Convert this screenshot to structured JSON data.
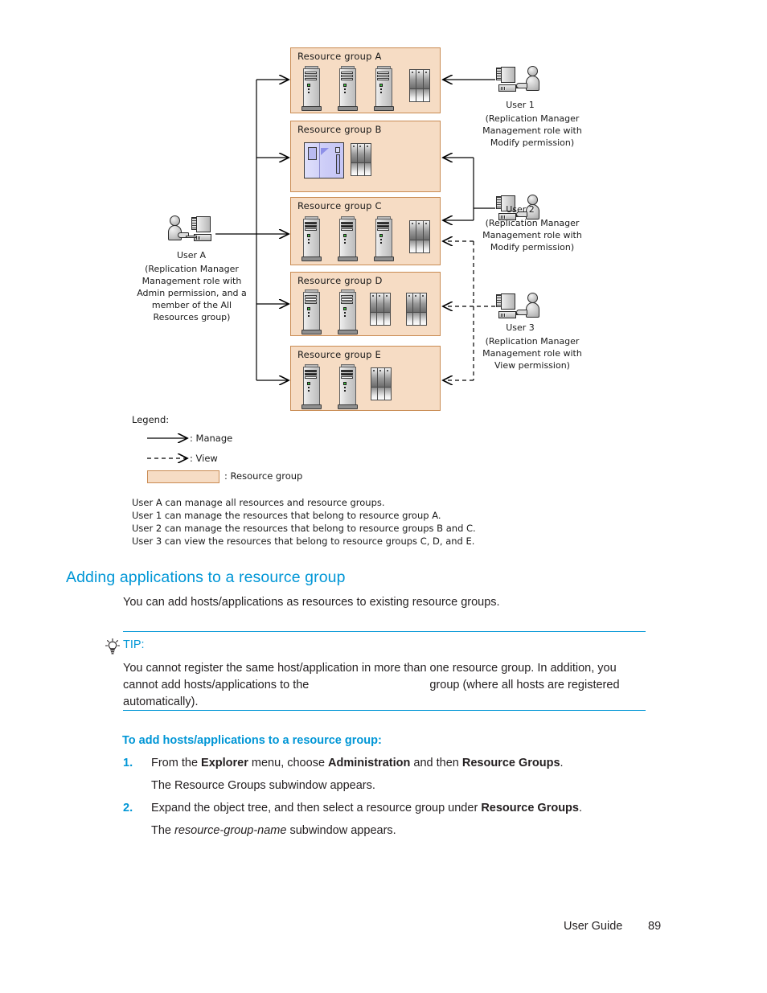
{
  "figure": {
    "resource_groups": [
      {
        "id": "A",
        "title": "Resource group A",
        "servers": 3,
        "arrays": 1,
        "app": false,
        "dark": false
      },
      {
        "id": "B",
        "title": "Resource group B",
        "servers": 0,
        "arrays": 1,
        "app": true,
        "dark": false
      },
      {
        "id": "C",
        "title": "Resource group C",
        "servers": 3,
        "arrays": 1,
        "app": false,
        "dark": true
      },
      {
        "id": "D",
        "title": "Resource group D",
        "servers": 2,
        "arrays": 2,
        "app": false,
        "dark": false
      },
      {
        "id": "E",
        "title": "Resource group E",
        "servers": 2,
        "arrays": 1,
        "app": false,
        "dark": true
      }
    ],
    "users": [
      {
        "key": "userA",
        "name": "User A",
        "detail": "(Replication Manager\nManagement role with\nAdmin permission, and a\nmember of the All\nResources group)"
      },
      {
        "key": "user1",
        "name": "User 1",
        "detail": "(Replication Manager\nManagement role with\nModify permission)"
      },
      {
        "key": "user2",
        "name": "User 2",
        "detail": "(Replication Manager\nManagement role with\nModify permission)"
      },
      {
        "key": "user3",
        "name": "User 3",
        "detail": "(Replication Manager\nManagement role with\nView permission)"
      }
    ],
    "legend": {
      "title": "Legend:",
      "manage": ": Manage",
      "view": ": View",
      "resource_group": ": Resource group"
    },
    "notes": [
      "User A can manage all resources and resource groups.",
      "User 1 can manage the resources that belong to resource group A.",
      "User 2 can manage the resources that belong to resource groups B and C.",
      "User 3 can view the resources that belong to resource groups C, D, and E."
    ]
  },
  "content": {
    "heading": "Adding applications to a resource group",
    "intro": "You can add hosts/applications as resources to existing resource groups.",
    "tip": {
      "label": "TIP:",
      "text_before_gap": "You cannot register the same host/application in more than one resource group. In addition, you cannot add hosts/applications to the",
      "text_after_gap": "group (where all hosts are registered automatically)."
    },
    "task_title": "To add hosts/applications to a resource group:",
    "steps": [
      {
        "num": "1.",
        "parts": [
          {
            "t": "From the ",
            "b": false,
            "i": false
          },
          {
            "t": "Explorer",
            "b": true,
            "i": false
          },
          {
            "t": " menu, choose ",
            "b": false,
            "i": false
          },
          {
            "t": "Administration",
            "b": true,
            "i": false
          },
          {
            "t": " and then ",
            "b": false,
            "i": false
          },
          {
            "t": "Resource Groups",
            "b": true,
            "i": false
          },
          {
            "t": ".",
            "b": false,
            "i": false
          }
        ],
        "result_parts": [
          {
            "t": "The Resource Groups subwindow appears.",
            "b": false,
            "i": false
          }
        ]
      },
      {
        "num": "2.",
        "parts": [
          {
            "t": "Expand the object tree, and then select a resource group under ",
            "b": false,
            "i": false
          },
          {
            "t": "Resource Groups",
            "b": true,
            "i": false
          },
          {
            "t": ".",
            "b": false,
            "i": false
          }
        ],
        "result_parts": [
          {
            "t": "The ",
            "b": false,
            "i": false
          },
          {
            "t": "resource-group-name",
            "b": false,
            "i": true
          },
          {
            "t": " subwindow appears.",
            "b": false,
            "i": false
          }
        ]
      }
    ]
  },
  "footer": {
    "label": "User Guide",
    "page_number": "89"
  },
  "colors": {
    "accent_blue": "#0096d6",
    "group_fill": "#f6dcc4",
    "group_border": "#c98b52",
    "body_text": "#231f20"
  }
}
